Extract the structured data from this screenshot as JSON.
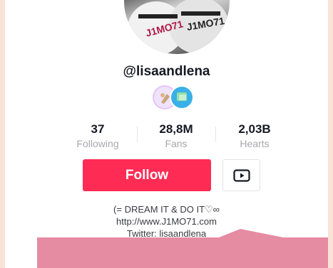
{
  "profile": {
    "avatar_text_1": "J1MO71",
    "avatar_text_2": "J1MO71",
    "username": "@lisaandlena"
  },
  "stats": {
    "following": {
      "value": "37",
      "label": "Following"
    },
    "fans": {
      "value": "28,8M",
      "label": "Fans"
    },
    "hearts": {
      "value": "2,03B",
      "label": "Hearts"
    }
  },
  "actions": {
    "follow_label": "Follow",
    "video_icon": "play-video-icon"
  },
  "bio": {
    "line1": "(=  DREAM IT & DO IT♡∞",
    "line2": "http://www.J1MO71.com",
    "line3": "Twitter: lisaandlena"
  },
  "colors": {
    "accent": "#fe2c55",
    "background": "#f9e3d9",
    "overlay": "#e58ba2"
  }
}
